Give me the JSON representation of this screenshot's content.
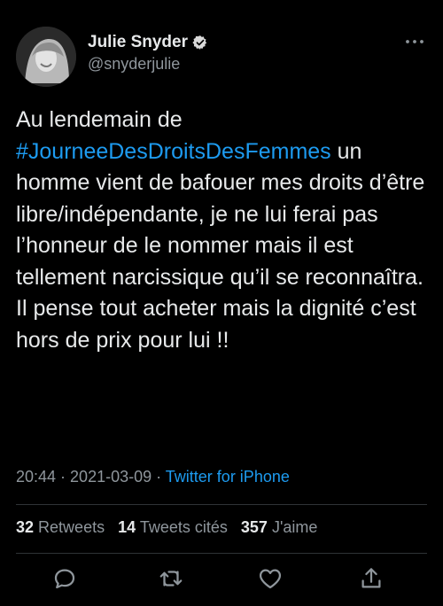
{
  "author": {
    "display_name": "Julie Snyder",
    "handle": "@snyderjulie",
    "verified": true
  },
  "tweet": {
    "text_before": "Au lendemain de\n",
    "hashtag": "#JourneeDesDroitsDesFemmes",
    "text_after": " un homme vient de bafouer mes droits d’être libre/indépendante, je ne lui ferai pas l’honneur de le nommer mais il est tellement narcissique qu’il se reconnaîtra. Il pense  tout acheter mais la dignité c’est hors de prix pour lui !!"
  },
  "meta": {
    "time": "20:44",
    "sep1": " · ",
    "date": "2021-03-09",
    "sep2": " · ",
    "source": "Twitter for iPhone"
  },
  "stats": {
    "retweets_count": "32",
    "retweets_label": "Retweets",
    "quotes_count": "14",
    "quotes_label": "Tweets cités",
    "likes_count": "357",
    "likes_label": "J'aime"
  },
  "icons": {
    "more": "more-horizontal-icon",
    "reply": "reply-icon",
    "retweet": "retweet-icon",
    "like": "like-heart-icon",
    "share": "share-icon",
    "verified": "verified-badge-icon"
  },
  "colors": {
    "background": "#000000",
    "text": "#e7e9ea",
    "secondary": "#8f969c",
    "accent": "#1d9bf0",
    "divider": "#2f3336"
  }
}
